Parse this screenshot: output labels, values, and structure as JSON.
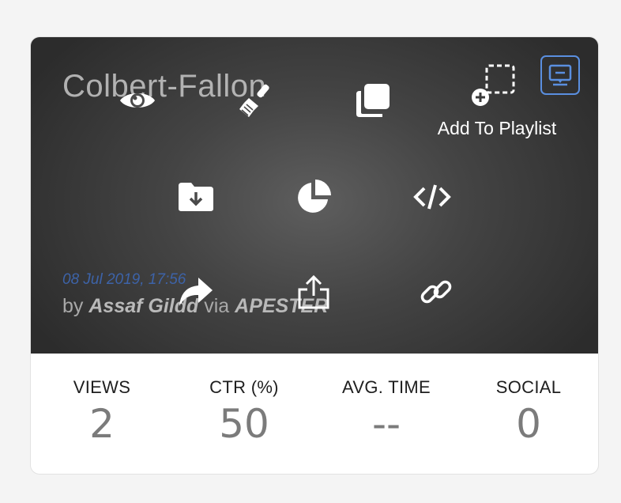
{
  "card": {
    "title": "Colbert-Fallon",
    "date": "08 Jul 2019, 17:56",
    "byline": {
      "prefix": "by",
      "author": "Assaf Gildd",
      "via": "via",
      "source": "APESTER"
    }
  },
  "actions": {
    "preview": "eye-icon",
    "design": "brush-icon",
    "duplicate": "duplicate-icon",
    "add_to_playlist_label": "Add To Playlist",
    "download": "folder-download-icon",
    "analytics": "pie-chart-icon",
    "embed": "code-icon",
    "share": "share-arrow-icon",
    "export": "export-icon",
    "link": "link-icon",
    "monitor": "monitor-icon"
  },
  "stats": [
    {
      "label": "VIEWS",
      "value": "2"
    },
    {
      "label": "CTR (%)",
      "value": "50"
    },
    {
      "label": "AVG. TIME",
      "value": "--"
    },
    {
      "label": "SOCIAL",
      "value": "0"
    }
  ],
  "colors": {
    "accent": "#5a8fe0",
    "date": "#3d63a8",
    "stat_value": "#7b7b7b"
  }
}
